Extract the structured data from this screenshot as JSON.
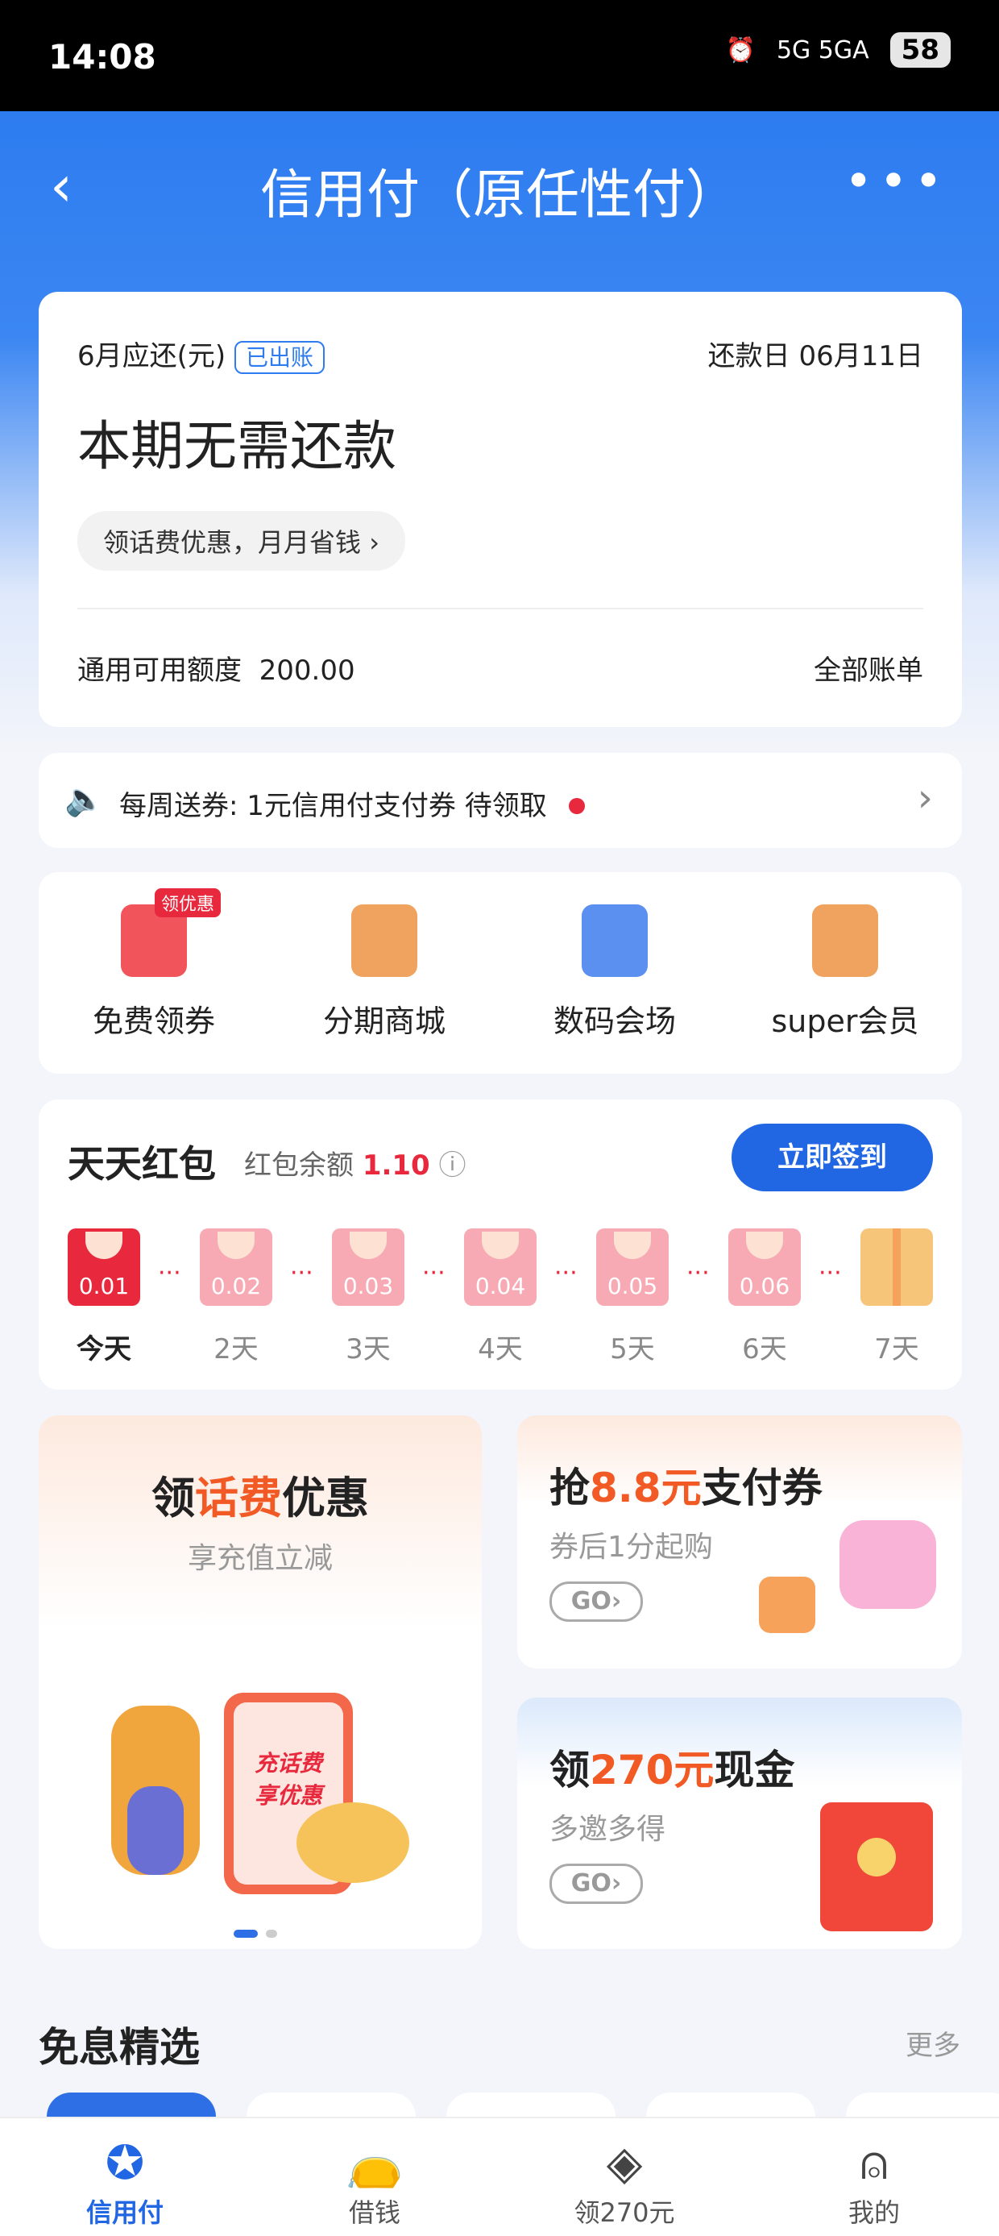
{
  "status_bar": {
    "time": "14:08",
    "network": "5G  5GA",
    "battery": "58"
  },
  "nav": {
    "title": "信用付（原任性付）",
    "back_icon": "chevron-left-icon",
    "more_icon": "more-dots-icon"
  },
  "bill": {
    "label": "6月应还(元)",
    "tag": "已出账",
    "due_date": "还款日 06月11日",
    "amount_text": "本期无需还款",
    "promo_pill": "领话费优惠，月月省钱",
    "limit_label": "通用可用额度",
    "limit_value": "200.00",
    "all_bills": "全部账单"
  },
  "notice": {
    "text": "每周送券: 1元信用付支付券 待领取"
  },
  "quick_actions": [
    {
      "label": "免费领券",
      "badge": "领优惠",
      "color": "#f2545b"
    },
    {
      "label": "分期商城",
      "color": "#f0a35e"
    },
    {
      "label": "数码会场",
      "color": "#5b8ff0"
    },
    {
      "label": "super会员",
      "color": "#f0a35e"
    }
  ],
  "red_packet": {
    "title": "天天红包",
    "balance_label": "红包余额",
    "balance": "1.10",
    "sign_button": "立即签到",
    "days": [
      {
        "amount": "0.01",
        "label": "今天"
      },
      {
        "amount": "0.02",
        "label": "2天"
      },
      {
        "amount": "0.03",
        "label": "3天"
      },
      {
        "amount": "0.04",
        "label": "4天"
      },
      {
        "amount": "0.05",
        "label": "5天"
      },
      {
        "amount": "0.06",
        "label": "6天"
      },
      {
        "amount": "",
        "label": "7天"
      }
    ]
  },
  "promos": {
    "p1": {
      "title_a": "领",
      "title_b": "话费",
      "title_c": "优惠",
      "subtitle": "享充值立减",
      "phone_text_1": "充话费",
      "phone_text_2": "享优惠"
    },
    "p2": {
      "title_a": "抢",
      "title_b": "8.8元",
      "title_c": "支付券",
      "subtitle": "券后1分起购",
      "go": "GO›"
    },
    "p3": {
      "title_a": "领",
      "title_b": "270元",
      "title_c": "现金",
      "subtitle": "多邀多得",
      "go": "GO›"
    }
  },
  "section": {
    "title": "免息精选",
    "more": "更多"
  },
  "tabs": [
    {
      "label": "信用付",
      "icon": "credit-pay-icon"
    },
    {
      "label": "借钱",
      "icon": "money-bag-icon"
    },
    {
      "label": "领270元",
      "icon": "coin-icon"
    },
    {
      "label": "我的",
      "icon": "profile-icon"
    }
  ],
  "colors": {
    "brand": "#2166e2",
    "accent": "#f25a25",
    "red": "#e8283c"
  }
}
